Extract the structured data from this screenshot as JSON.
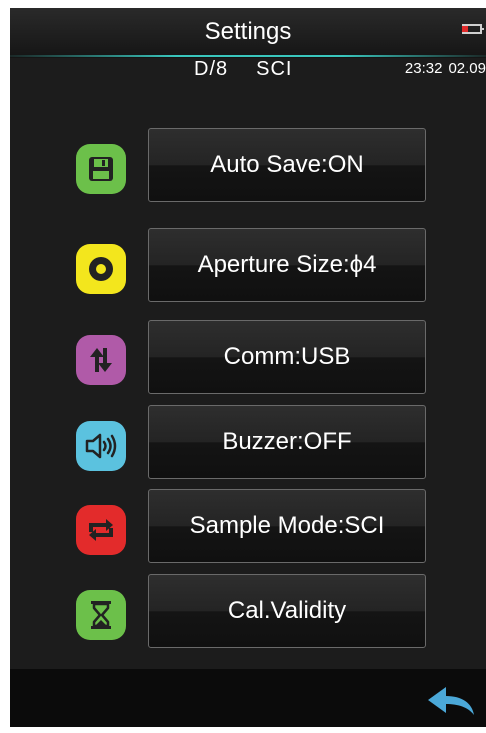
{
  "header": {
    "title": "Settings",
    "geometry": "D/8",
    "mode": "SCI",
    "time": "23:32",
    "date": "02.09"
  },
  "menu": {
    "items": [
      {
        "label": "Auto Save:ON",
        "icon": "save-icon",
        "icon_color": "#6cc04a"
      },
      {
        "label": "Aperture Size:ϕ4",
        "icon": "aperture-icon",
        "icon_color": "#f3e61d"
      },
      {
        "label": "Comm:USB",
        "icon": "transfer-icon",
        "icon_color": "#b05aa8"
      },
      {
        "label": "Buzzer:OFF",
        "icon": "speaker-icon",
        "icon_color": "#5bc2df"
      },
      {
        "label": "Sample Mode:SCI",
        "icon": "repeat-icon",
        "icon_color": "#e32b2b"
      },
      {
        "label": "Cal.Validity",
        "icon": "hourglass-icon",
        "icon_color": "#6cc04a"
      }
    ]
  },
  "status": {
    "battery_color": "#e02a2a",
    "accent": "#39c6bd"
  },
  "footer": {
    "back_icon": "back-arrow-icon",
    "back_color": "#4ba8d8"
  }
}
